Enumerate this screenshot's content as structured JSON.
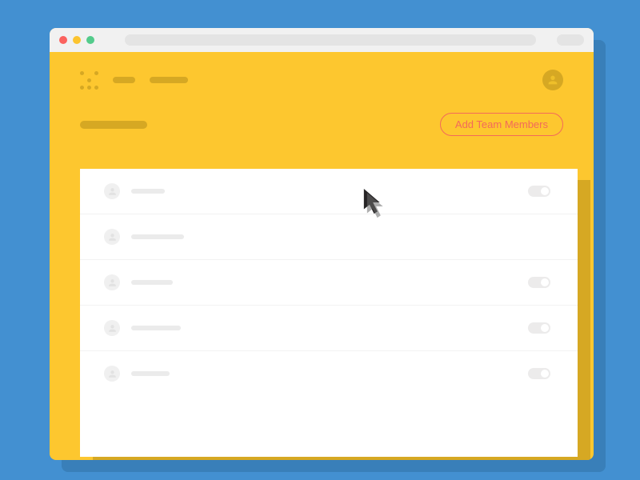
{
  "colors": {
    "page_bg": "#4390d1",
    "window_bg": "#fdc72f",
    "accent": "#f36a5a",
    "panel_bg": "#ffffff"
  },
  "titlebar": {
    "traffic_lights": [
      "close",
      "minimize",
      "zoom"
    ]
  },
  "header": {
    "nav_items": [
      "",
      ""
    ]
  },
  "actions": {
    "add_team_label": "Add Team Members"
  },
  "members": [
    {
      "name_width": 42,
      "toggle": true
    },
    {
      "name_width": 66,
      "toggle": false
    },
    {
      "name_width": 52,
      "toggle": true
    },
    {
      "name_width": 62,
      "toggle": true
    },
    {
      "name_width": 48,
      "toggle": true
    }
  ]
}
